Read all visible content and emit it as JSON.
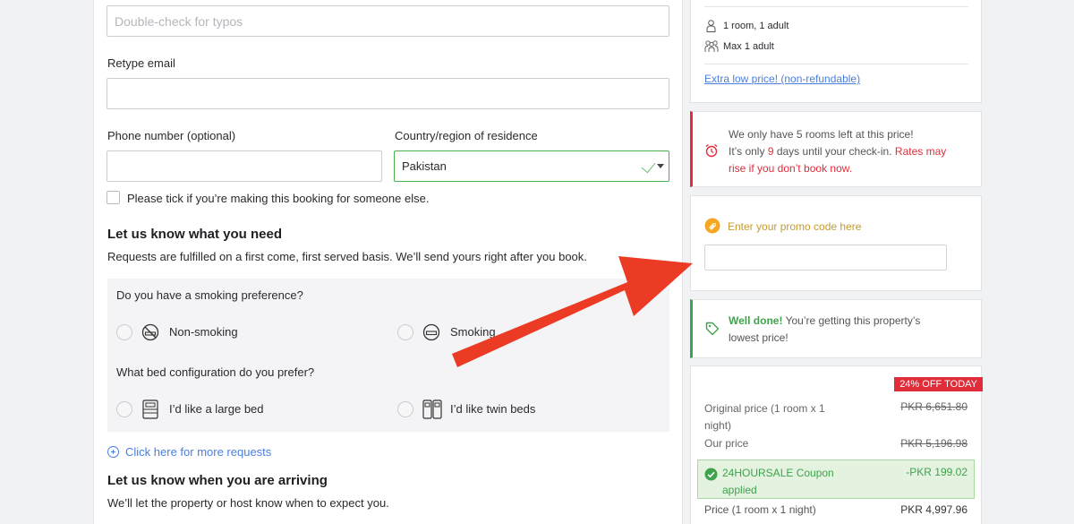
{
  "form": {
    "email_placeholder": "Double-check for typos",
    "retype_email_label": "Retype email",
    "phone_label": "Phone number (optional)",
    "country_label": "Country/region of residence",
    "country_value": "Pakistan",
    "booking_for_other_label": "Please tick if you’re making this booking for someone else."
  },
  "requests": {
    "title": "Let us know what you need",
    "description": "Requests are fulfilled on a first come, first served basis. We’ll send yours right after you book.",
    "smoking_question": "Do you have a smoking preference?",
    "smoking_options": [
      "Non-smoking",
      "Smoking"
    ],
    "bed_question": "What bed configuration do you prefer?",
    "bed_options": [
      "I’d like a large bed",
      "I’d like twin beds"
    ],
    "more_link": "Click here for more requests"
  },
  "arrival": {
    "title": "Let us know when you are arriving",
    "description": "We’ll let the property or host know when to expect you."
  },
  "room_summary": {
    "rooms": "1 room, 1 adult",
    "max": "Max 1 adult",
    "rate_link": "Extra low price! (non-refundable)"
  },
  "urgency": {
    "line1": "We only have 5 rooms left at this price!",
    "line2_prefix": "It’s only ",
    "days": "9",
    "line2_mid": " days until your check-in. ",
    "line2_red": "Rates may",
    "line3_red": "rise if you don’t book now."
  },
  "promo": {
    "label": "Enter your promo code here"
  },
  "lowest": {
    "bold": "Well done!",
    "text": " You’re getting this property’s",
    "text2": "lowest price!"
  },
  "pricing": {
    "badge": "24% OFF TODAY",
    "original_label_1": "Original price (1 room x 1",
    "original_label_2": "night)",
    "original_value": "PKR 6,651.80",
    "our_label": "Our price",
    "our_value": "PKR 5,196.98",
    "coupon_label_1": "24HOURSALE Coupon",
    "coupon_label_2": "applied",
    "coupon_value": "-PKR 199.02",
    "price_label": "Price (1 room x 1 night)",
    "price_value": "PKR 4,997.96"
  },
  "colors": {
    "accent_blue": "#4a7fe0",
    "alert_red": "#e12d39",
    "success_green": "#3fa34d",
    "arrow_red": "#ec3b24"
  }
}
